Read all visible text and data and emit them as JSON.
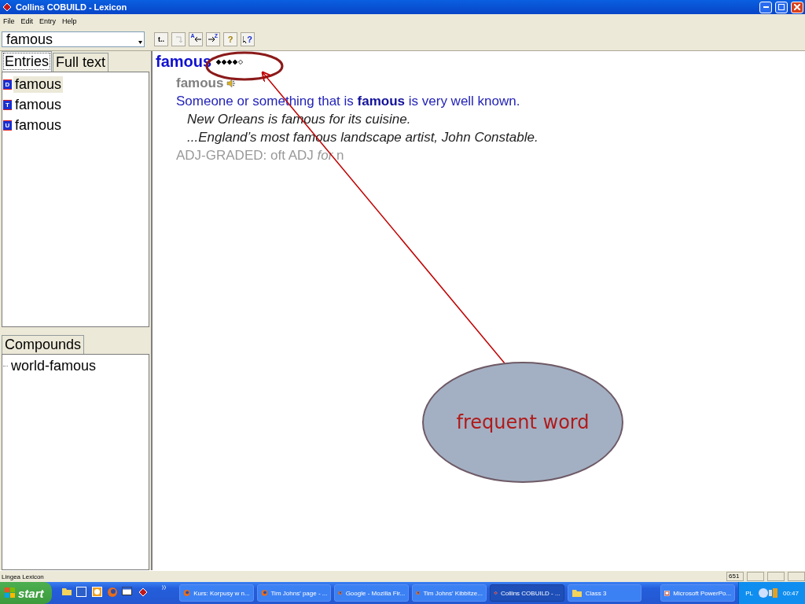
{
  "window": {
    "title": "Collins COBUILD - Lexicon"
  },
  "menu": [
    "File",
    "Edit",
    "Entry",
    "Help"
  ],
  "search": {
    "value": "famous"
  },
  "toolbar": [
    {
      "kind": "text",
      "label": "t.."
    },
    {
      "kind": "return",
      "disabled": true
    },
    {
      "kind": "sort-left",
      "label": "A"
    },
    {
      "kind": "sort-right",
      "label": "Z"
    },
    {
      "kind": "help",
      "label": "?"
    },
    {
      "kind": "context-help",
      "label": "?"
    }
  ],
  "left_tabs": [
    {
      "label": "Entries",
      "selected": true
    },
    {
      "label": "Full text",
      "selected": false
    }
  ],
  "entries": [
    {
      "badge": "D",
      "label": "famous",
      "selected": true
    },
    {
      "badge": "T",
      "label": "famous",
      "selected": false
    },
    {
      "badge": "U",
      "label": "famous",
      "selected": false
    }
  ],
  "compounds": {
    "tab": "Compounds",
    "items": [
      "world-famous"
    ]
  },
  "article": {
    "headword": "famous",
    "stars": 4,
    "form": "famous",
    "definition": "Someone or something that is **famous** is very well known.",
    "examples": [
      "New Orleans is famous for its cuisine.",
      "...England’s most famous landscape artist, John Constable."
    ],
    "grammar": "ADJ-GRADED: oft ADJ *for* n"
  },
  "annotation": {
    "callout": "frequent word"
  },
  "status_bar": {
    "text": "Lingea Lexicon",
    "count": "651"
  },
  "taskbar": {
    "start": "start",
    "quick_launch": [
      {
        "kind": "folder"
      },
      {
        "kind": "word"
      },
      {
        "kind": "outlook"
      },
      {
        "kind": "firefox"
      },
      {
        "kind": "desktop"
      },
      {
        "kind": "lexicon"
      }
    ],
    "tasks": [
      {
        "kind": "firefox",
        "label": "Kurs: Korpusy w n...",
        "selected": false
      },
      {
        "kind": "firefox",
        "label": "Tim Johns' page - ...",
        "selected": false
      },
      {
        "kind": "firefox",
        "label": "Google - Mozilla Fir...",
        "selected": false
      },
      {
        "kind": "firefox",
        "label": "Tim Johns' Kibbitze...",
        "selected": false
      },
      {
        "kind": "lexicon",
        "label": "Collins COBUILD - ...",
        "selected": true
      },
      {
        "kind": "folder",
        "label": "Class 3",
        "selected": false
      },
      {
        "kind": "powerpoint",
        "label": "Microsoft PowerPo...",
        "selected": false
      }
    ],
    "language": "PL",
    "clock": "00:47"
  }
}
